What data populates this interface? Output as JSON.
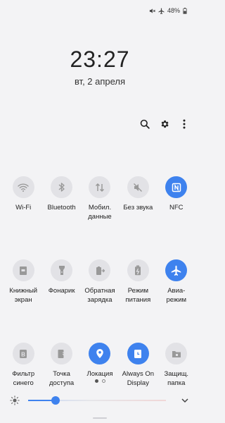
{
  "status": {
    "battery_text": "48%",
    "icons": [
      "mute-icon",
      "airplane-icon",
      "battery-icon"
    ]
  },
  "clock": {
    "time": "23:27",
    "date": "вт, 2 апреля"
  },
  "toolbar": {
    "icons": [
      "search-icon",
      "gear-icon",
      "more-vert-icon"
    ]
  },
  "tiles": [
    {
      "name": "wifi",
      "label": "Wi-Fi",
      "icon": "wifi-icon",
      "active": false
    },
    {
      "name": "bluetooth",
      "label": "Bluetooth",
      "icon": "bluetooth-icon",
      "active": false
    },
    {
      "name": "mobile-data",
      "label": "Мобил.\nданные",
      "icon": "mobile-data-icon",
      "active": false
    },
    {
      "name": "sound",
      "label": "Без звука",
      "icon": "mute-icon",
      "active": false
    },
    {
      "name": "nfc",
      "label": "NFC",
      "icon": "nfc-icon",
      "active": true
    },
    {
      "name": "reading-mode",
      "label": "Книжный\nэкран",
      "icon": "book-icon",
      "active": false
    },
    {
      "name": "flashlight",
      "label": "Фонарик",
      "icon": "flashlight-icon",
      "active": false
    },
    {
      "name": "reverse-charge",
      "label": "Обратная\nзарядка",
      "icon": "reverse-charge-icon",
      "active": false
    },
    {
      "name": "power-mode",
      "label": "Режим\nпитания",
      "icon": "battery-mode-icon",
      "active": false
    },
    {
      "name": "airplane",
      "label": "Авиа-\nрежим",
      "icon": "airplane-icon",
      "active": true
    },
    {
      "name": "blue-filter",
      "label": "Фильтр\nсинего",
      "icon": "blue-filter-icon",
      "active": false
    },
    {
      "name": "hotspot",
      "label": "Точка\nдоступа",
      "icon": "hotspot-icon",
      "active": false
    },
    {
      "name": "location",
      "label": "Локация",
      "icon": "location-icon",
      "active": true
    },
    {
      "name": "always-on-display",
      "label": "Always On\nDisplay",
      "icon": "clock-icon",
      "active": true
    },
    {
      "name": "secure-folder",
      "label": "Защищ.\nпапка",
      "icon": "secure-folder-icon",
      "active": false
    }
  ],
  "pages": {
    "current": 1,
    "total": 2
  },
  "brightness": {
    "level": 0.2
  },
  "colors": {
    "accent": "#3e82ee",
    "tile_bg": "#e2e2e6",
    "background": "#f3f3f5"
  }
}
